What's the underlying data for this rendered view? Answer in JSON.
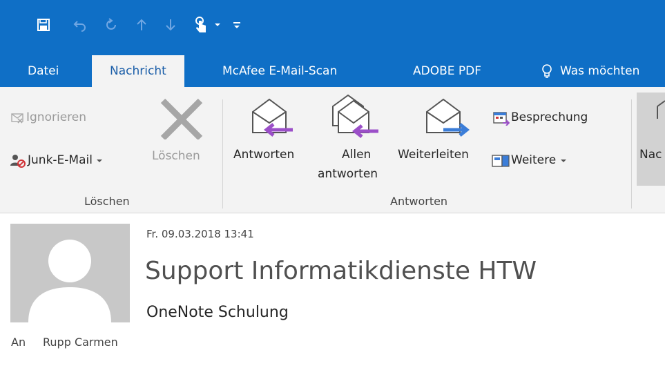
{
  "quick_access": {
    "icons": [
      "save-icon",
      "undo-icon",
      "redo-icon",
      "up-arrow-icon",
      "down-arrow-icon",
      "touch-mode-icon",
      "dropdown-icon",
      "customize-icon"
    ]
  },
  "tabs": [
    {
      "label": "Datei"
    },
    {
      "label": "Nachricht"
    },
    {
      "label": "McAfee E-Mail-Scan"
    },
    {
      "label": "ADOBE PDF"
    },
    {
      "label": "Was möchten"
    }
  ],
  "ribbon": {
    "loeschen_group": {
      "ignorieren": "Ignorieren",
      "junk": "Junk-E-Mail",
      "loeschen": "Löschen",
      "label": "Löschen"
    },
    "antworten_group": {
      "antworten": "Antworten",
      "allen1": "Allen",
      "allen2": "antworten",
      "weiterleiten": "Weiterleiten",
      "besprechung": "Besprechung",
      "weitere": "Weitere",
      "label": "Antworten"
    },
    "next_group": {
      "truncated": "Nac"
    }
  },
  "colors": {
    "title_bar": "#0f6fc6",
    "ribbon_bg": "#f3f3f3",
    "active_tab_text": "#1b5ea8",
    "reply_arrow": "#9b4fc8",
    "forward_arrow": "#3b7dd8"
  },
  "message": {
    "datetime": "Fr. 09.03.2018 13:41",
    "sender": "Support Informatikdienste HTW",
    "subject": "OneNote Schulung",
    "to_label": "An",
    "to_value": "Rupp Carmen"
  }
}
